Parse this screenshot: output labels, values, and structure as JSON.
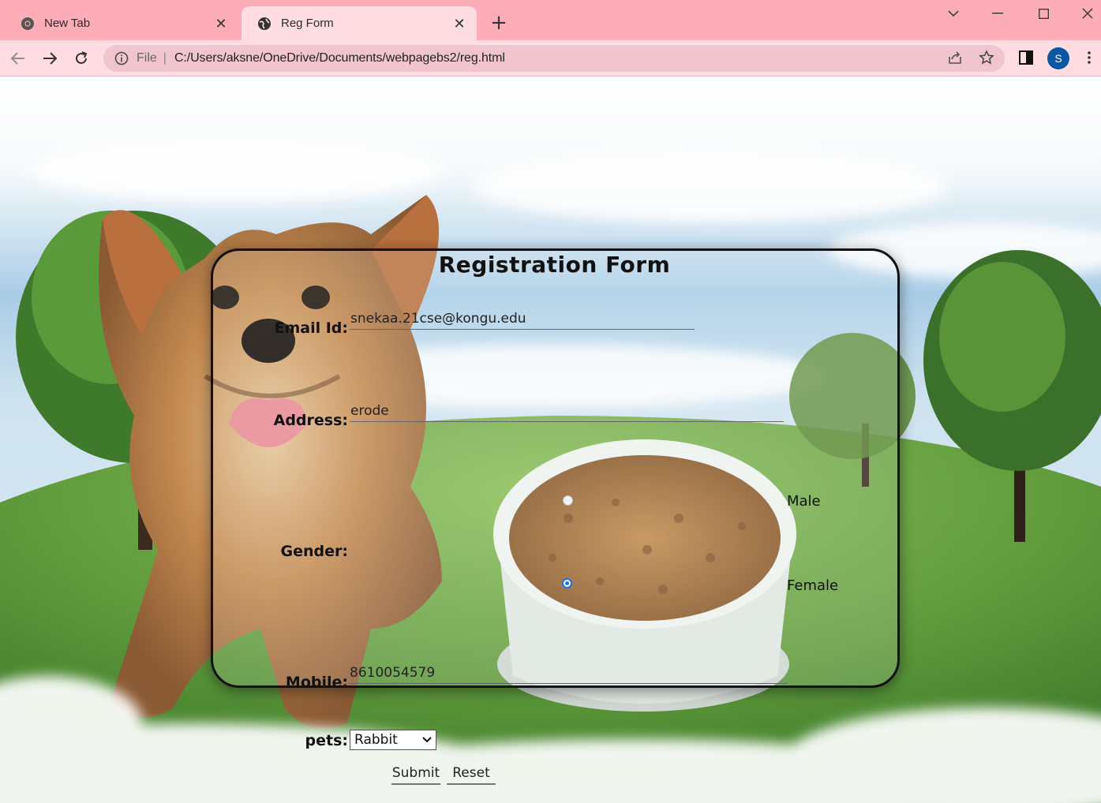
{
  "browser": {
    "tabs": [
      {
        "label": "New Tab",
        "active": false,
        "icon": "chrome-icon"
      },
      {
        "label": "Reg Form",
        "active": true,
        "icon": "globe-icon"
      }
    ],
    "address": {
      "scheme": "File",
      "url": "C:/Users/aksne/OneDrive/Documents/webpagebs2/reg.html"
    },
    "profile_initial": "S"
  },
  "form": {
    "title": "Registration Form",
    "email": {
      "label": "Email Id:",
      "value": "snekaa.21cse@kongu.edu"
    },
    "address": {
      "label": "Address:",
      "value": "erode"
    },
    "gender": {
      "label": "Gender:",
      "options": [
        "Male",
        "Female"
      ],
      "selected": "Female"
    },
    "mobile": {
      "label": "Mobile:",
      "value": "8610054579"
    },
    "pets": {
      "label": "pets:",
      "selected": "Rabbit"
    },
    "submit_label": "Submit",
    "reset_label": "Reset"
  },
  "colors": {
    "tabbar": "#fdadb8",
    "toolbar": "#ffdde3",
    "omnibox": "#f1c5cd",
    "radio_accent": "#1a73e8",
    "avatar": "#0b57a4"
  }
}
